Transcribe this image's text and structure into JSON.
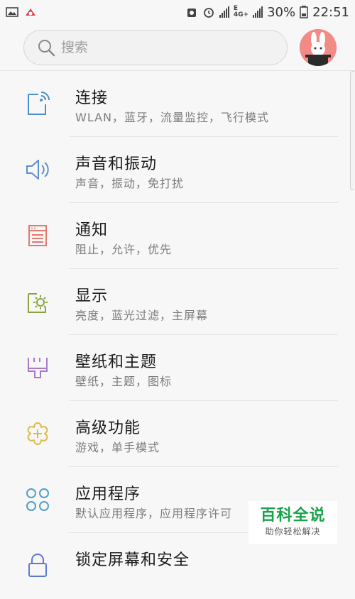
{
  "status": {
    "battery": "30%",
    "time": "22:51",
    "net_top": "E",
    "net_bottom": "4G+"
  },
  "search": {
    "placeholder": "搜索"
  },
  "menu": [
    {
      "title": "连接",
      "subtitle": "WLAN，蓝牙，流量监控，飞行模式",
      "icon": "connections-icon",
      "color": "#4a90c8"
    },
    {
      "title": "声音和振动",
      "subtitle": "声音，振动，免打扰",
      "icon": "speaker-icon",
      "color": "#5b8ed0"
    },
    {
      "title": "通知",
      "subtitle": "阻止，允许，优先",
      "icon": "notification-icon",
      "color": "#e07b6e"
    },
    {
      "title": "显示",
      "subtitle": "亮度，蓝光过滤，主屏幕",
      "icon": "display-icon",
      "color": "#8aa33c"
    },
    {
      "title": "壁纸和主题",
      "subtitle": "壁纸，主题，图标",
      "icon": "paintbrush-icon",
      "color": "#a97ac8"
    },
    {
      "title": "高级功能",
      "subtitle": "游戏，单手模式",
      "icon": "advanced-features-icon",
      "color": "#e0b84a"
    },
    {
      "title": "应用程序",
      "subtitle": "默认应用程序，应用程序许可",
      "icon": "apps-icon",
      "color": "#4fa0c8"
    },
    {
      "title": "锁定屏幕和安全",
      "subtitle": "",
      "icon": "lock-icon",
      "color": "#5b7bd0"
    }
  ],
  "watermark": {
    "title": "百科全说",
    "subtitle": "助你轻松解决"
  }
}
